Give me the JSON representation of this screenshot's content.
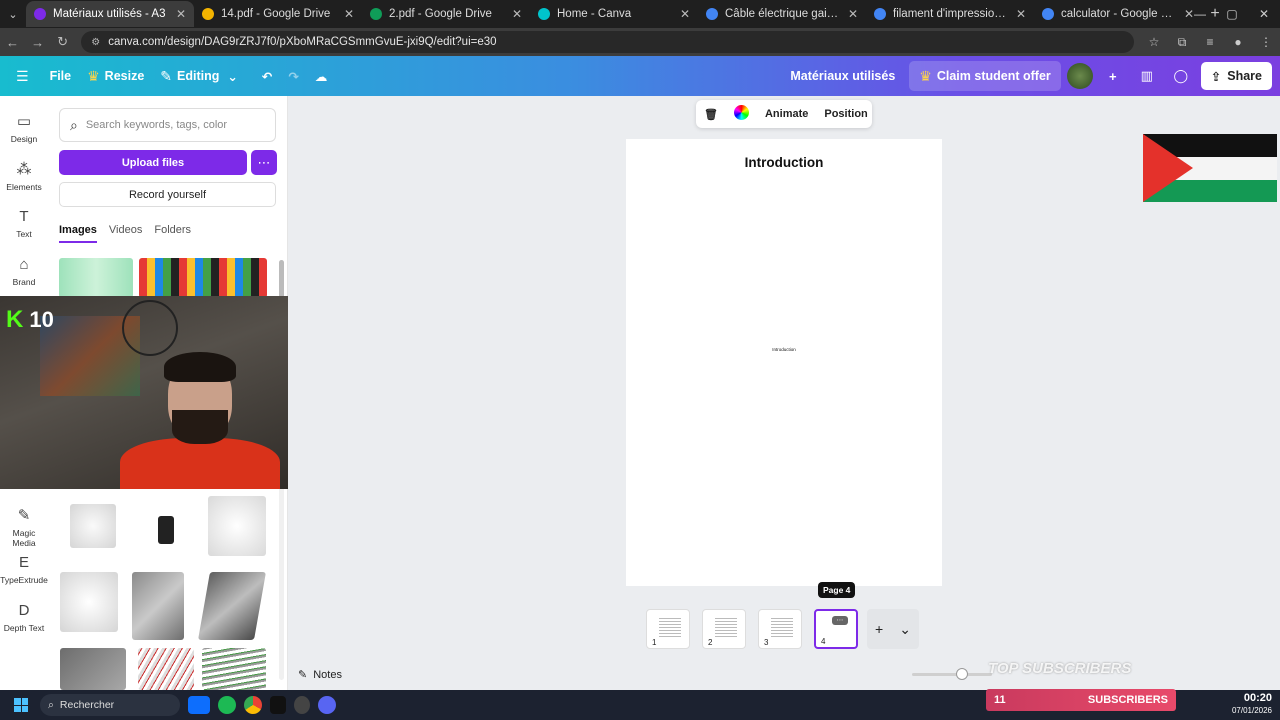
{
  "browser": {
    "tabs": [
      {
        "label": "Matériaux utilisés - A3",
        "color": "#7d2ae8",
        "active": true
      },
      {
        "label": "14.pdf - Google Drive",
        "color": "#f4b400"
      },
      {
        "label": "2.pdf - Google Drive",
        "color": "#0f9d58"
      },
      {
        "label": "Home - Canva",
        "color": "#00c4cc"
      },
      {
        "label": "Câble électrique gainé - Googl",
        "color": "#4285f4"
      },
      {
        "label": "filament d'impression 3d - Goo",
        "color": "#4285f4"
      },
      {
        "label": "calculator - Google Search",
        "color": "#4285f4"
      }
    ],
    "url": "canva.com/design/DAG9rZRJ7f0/pXboMRaCGSmmGvuE-jxi9Q/edit?ui=e30"
  },
  "header": {
    "file": "File",
    "resize": "Resize",
    "editing": "Editing",
    "doc_title": "Matériaux utilisés",
    "claim": "Claim student offer",
    "share": "Share"
  },
  "rail": [
    {
      "label": "Design",
      "icon": "▭"
    },
    {
      "label": "Elements",
      "icon": "⁂"
    },
    {
      "label": "Text",
      "icon": "T"
    },
    {
      "label": "Brand",
      "icon": "⌂"
    },
    {
      "label": "Magic Media",
      "icon": "✎"
    },
    {
      "label": "TypeExtrude",
      "icon": "E"
    },
    {
      "label": "Depth Text",
      "icon": "D"
    }
  ],
  "panel": {
    "search_placeholder": "Search keywords, tags, color",
    "upload": "Upload files",
    "record": "Record yourself",
    "tabs": [
      "Images",
      "Videos",
      "Folders"
    ]
  },
  "webcam": {
    "badge": "10"
  },
  "toolbar": {
    "animate": "Animate",
    "position": "Position"
  },
  "page": {
    "title": "Introduction",
    "small_text": "Introduction"
  },
  "pages": {
    "tooltip": "Page 4",
    "numbers": [
      "1",
      "2",
      "3",
      "4"
    ],
    "active": 4
  },
  "bottom": {
    "notes": "Notes",
    "overlay": "TOP SUBSCRIBERS"
  },
  "taskbar": {
    "search": "Rechercher",
    "subscribers_count": "11",
    "subscribers_label": "SUBSCRIBERS",
    "time": "00:20",
    "date": "07/01/2026"
  },
  "colors": {
    "accent": "#7d2ae8",
    "flag_red": "#e4312b",
    "flag_green": "#149954"
  }
}
